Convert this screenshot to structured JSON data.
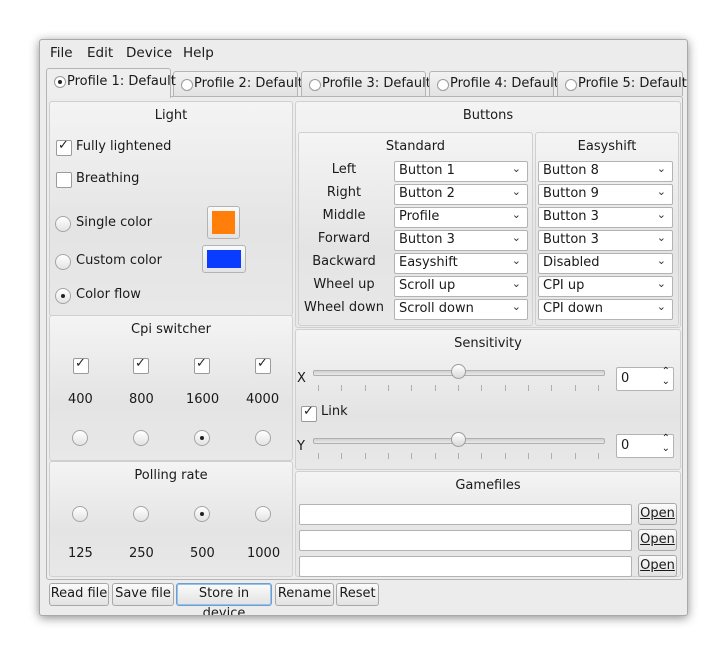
{
  "menu": [
    "File",
    "Edit",
    "Device",
    "Help"
  ],
  "tabs": [
    "Profile 1: Default",
    "Profile 2: Default",
    "Profile 3: Default",
    "Profile 4: Default",
    "Profile 5: Default"
  ],
  "light": {
    "title": "Light",
    "fully_lightened": {
      "label": "Fully lightened",
      "checked": true
    },
    "breathing": {
      "label": "Breathing",
      "checked": false
    },
    "single_color": {
      "label": "Single color",
      "color": "#ff7f0a"
    },
    "custom_color": {
      "label": "Custom color",
      "color": "#0a3cff"
    },
    "color_flow": {
      "label": "Color flow",
      "selected": true
    }
  },
  "cpi": {
    "title": "Cpi switcher",
    "values": [
      "400",
      "800",
      "1600",
      "4000"
    ],
    "selected_index": 2
  },
  "polling": {
    "title": "Polling rate",
    "values": [
      "125",
      "250",
      "500",
      "1000"
    ],
    "selected_index": 2
  },
  "buttons": {
    "title": "Buttons",
    "standard_title": "Standard",
    "easyshift_title": "Easyshift",
    "rows": [
      {
        "label": "Left",
        "standard": "Button 1",
        "easyshift": "Button 8"
      },
      {
        "label": "Right",
        "standard": "Button 2",
        "easyshift": "Button 9"
      },
      {
        "label": "Middle",
        "standard": "Profile",
        "easyshift": "Button 3"
      },
      {
        "label": "Forward",
        "standard": "Button 3",
        "easyshift": "Button 3"
      },
      {
        "label": "Backward",
        "standard": "Easyshift",
        "easyshift": "Disabled"
      },
      {
        "label": "Wheel up",
        "standard": "Scroll up",
        "easyshift": "CPI up"
      },
      {
        "label": "Wheel down",
        "standard": "Scroll down",
        "easyshift": "CPI down"
      }
    ]
  },
  "sensitivity": {
    "title": "Sensitivity",
    "x_label": "X",
    "y_label": "Y",
    "link_label": "Link",
    "link_checked": true,
    "x_value": "0",
    "y_value": "0",
    "x_slider_fraction": 0.5,
    "y_slider_fraction": 0.5
  },
  "gamefiles": {
    "title": "Gamefiles",
    "open_label": "Open",
    "count": 3
  },
  "bottom_buttons": [
    "Read file",
    "Save file",
    "Store in device",
    "Rename",
    "Reset"
  ]
}
